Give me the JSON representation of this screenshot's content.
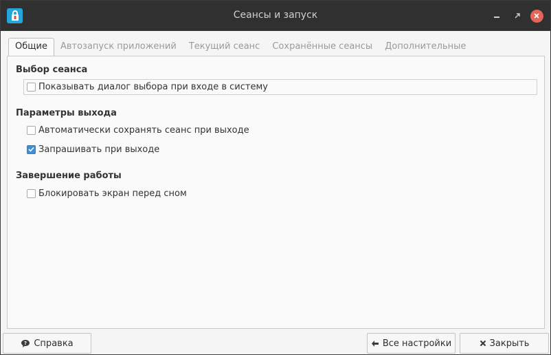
{
  "window": {
    "title": "Сеансы и запуск"
  },
  "tabs": [
    {
      "label": "Общие",
      "active": true
    },
    {
      "label": "Автозапуск приложений",
      "active": false
    },
    {
      "label": "Текущий сеанс",
      "active": false
    },
    {
      "label": "Сохранённые сеансы",
      "active": false
    },
    {
      "label": "Дополнительные",
      "active": false
    }
  ],
  "sections": {
    "session_select": {
      "title": "Выбор сеанса",
      "show_dialog": {
        "label": "Показывать диалог выбора при входе в систему",
        "checked": false
      }
    },
    "logout": {
      "title": "Параметры выхода",
      "auto_save": {
        "label": "Автоматически сохранять сеанс при выходе",
        "checked": false
      },
      "prompt": {
        "label": "Запрашивать при выходе",
        "checked": true
      }
    },
    "shutdown": {
      "title": "Завершение работы",
      "lock_screen": {
        "label": "Блокировать экран перед сном",
        "checked": false
      }
    }
  },
  "buttons": {
    "help": "Справка",
    "all_settings": "Все настройки",
    "close": "Закрыть"
  },
  "icons": {
    "app": "session-manager-icon",
    "help": "help-icon",
    "back": "arrow-left-icon",
    "close": "close-icon"
  },
  "colors": {
    "titlebar": "#303030",
    "close_button": "#e3665a",
    "checkbox_checked": "#3d8fd6",
    "app_icon": "#26a6d8"
  }
}
